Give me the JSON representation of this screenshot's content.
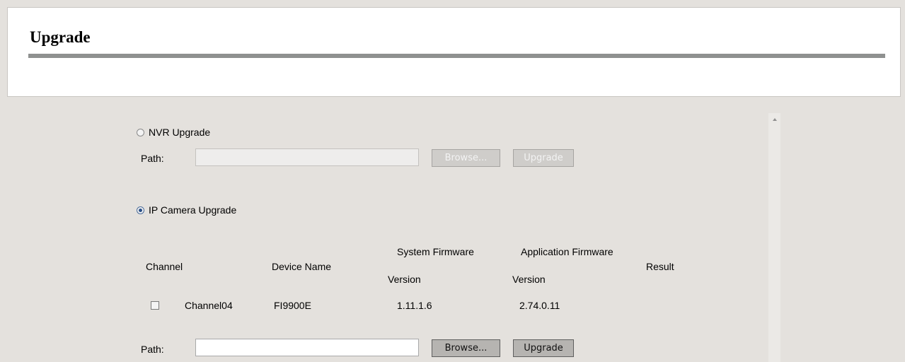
{
  "page": {
    "title": "Upgrade"
  },
  "nvr_upgrade": {
    "radio_label": "NVR Upgrade",
    "selected": false,
    "path_label": "Path:",
    "path_value": "",
    "browse_label": "Browse...",
    "upgrade_label": "Upgrade"
  },
  "ipc_upgrade": {
    "radio_label": "IP Camera Upgrade",
    "selected": true,
    "columns": {
      "channel": "Channel",
      "device_name": "Device Name",
      "sys_fw_line1": "System Firmware",
      "sys_fw_line2": "Version",
      "app_fw_line1": "Application Firmware",
      "app_fw_line2": "Version",
      "result": "Result"
    },
    "rows": [
      {
        "channel": "Channel04",
        "device_name": "FI9900E",
        "system_firmware": "1.11.1.6",
        "application_firmware": "2.74.0.11",
        "result": "",
        "checked": false
      }
    ],
    "path_label": "Path:",
    "path_value": "",
    "browse_label": "Browse...",
    "upgrade_label": "Upgrade"
  }
}
